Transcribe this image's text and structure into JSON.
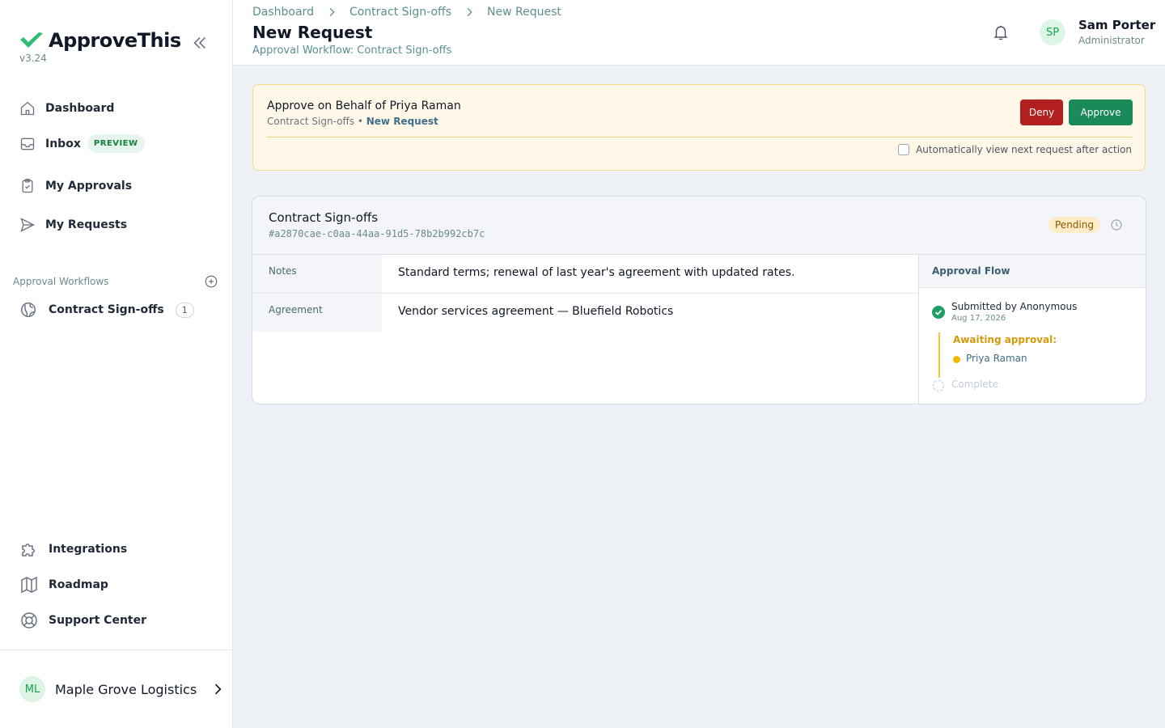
{
  "brand": {
    "name": "ApproveThis",
    "version": "v3.24",
    "accent": "#2fbf71"
  },
  "sidebar": {
    "nav": [
      {
        "label": "Dashboard",
        "icon": "home-icon"
      },
      {
        "label": "Inbox",
        "icon": "inbox-icon",
        "badge": "PREVIEW"
      },
      {
        "label": "My Approvals",
        "icon": "clipboard-check-icon"
      },
      {
        "label": "My Requests",
        "icon": "send-icon"
      }
    ],
    "workflows_title": "Approval Workflows",
    "workflows": [
      {
        "label": "Contract Sign-offs",
        "icon": "globe-icon",
        "count": "1"
      }
    ],
    "bottom": [
      {
        "label": "Integrations",
        "icon": "puzzle-icon"
      },
      {
        "label": "Roadmap",
        "icon": "map-icon"
      },
      {
        "label": "Support Center",
        "icon": "lifebuoy-icon"
      }
    ],
    "org": {
      "initials": "ML",
      "name": "Maple Grove Logistics"
    }
  },
  "header": {
    "breadcrumbs": [
      "Dashboard",
      "Contract Sign-offs",
      "New Request"
    ],
    "title": "New Request",
    "subtitle": "Approval Workflow: Contract Sign-offs",
    "user": {
      "initials": "SP",
      "name": "Sam Porter",
      "role": "Administrator"
    }
  },
  "behalf": {
    "title": "Approve on Behalf of Priya Raman",
    "crumb_workflow": "Contract Sign-offs",
    "crumb_sep": " • ",
    "crumb_request": "New Request",
    "deny_label": "Deny",
    "approve_label": "Approve",
    "auto_label": "Automatically view next request after action",
    "auto_checked": false
  },
  "request": {
    "title": "Contract Sign-offs",
    "id": "#a2870cae-c0aa-44aa-91d5-78b2b992cb7c",
    "status": "Pending",
    "fields": [
      {
        "label": "Notes",
        "value": "Standard terms; renewal of last year's agreement with updated rates."
      },
      {
        "label": "Agreement",
        "value": "Vendor services agreement — Bluefield Robotics"
      }
    ],
    "flow": {
      "title": "Approval Flow",
      "submitted": "Submitted by Anonymous",
      "submitted_date": "Aug 17, 2026",
      "awaiting": "Awaiting approval:",
      "approver": "Priya Raman",
      "complete": "Complete"
    }
  }
}
